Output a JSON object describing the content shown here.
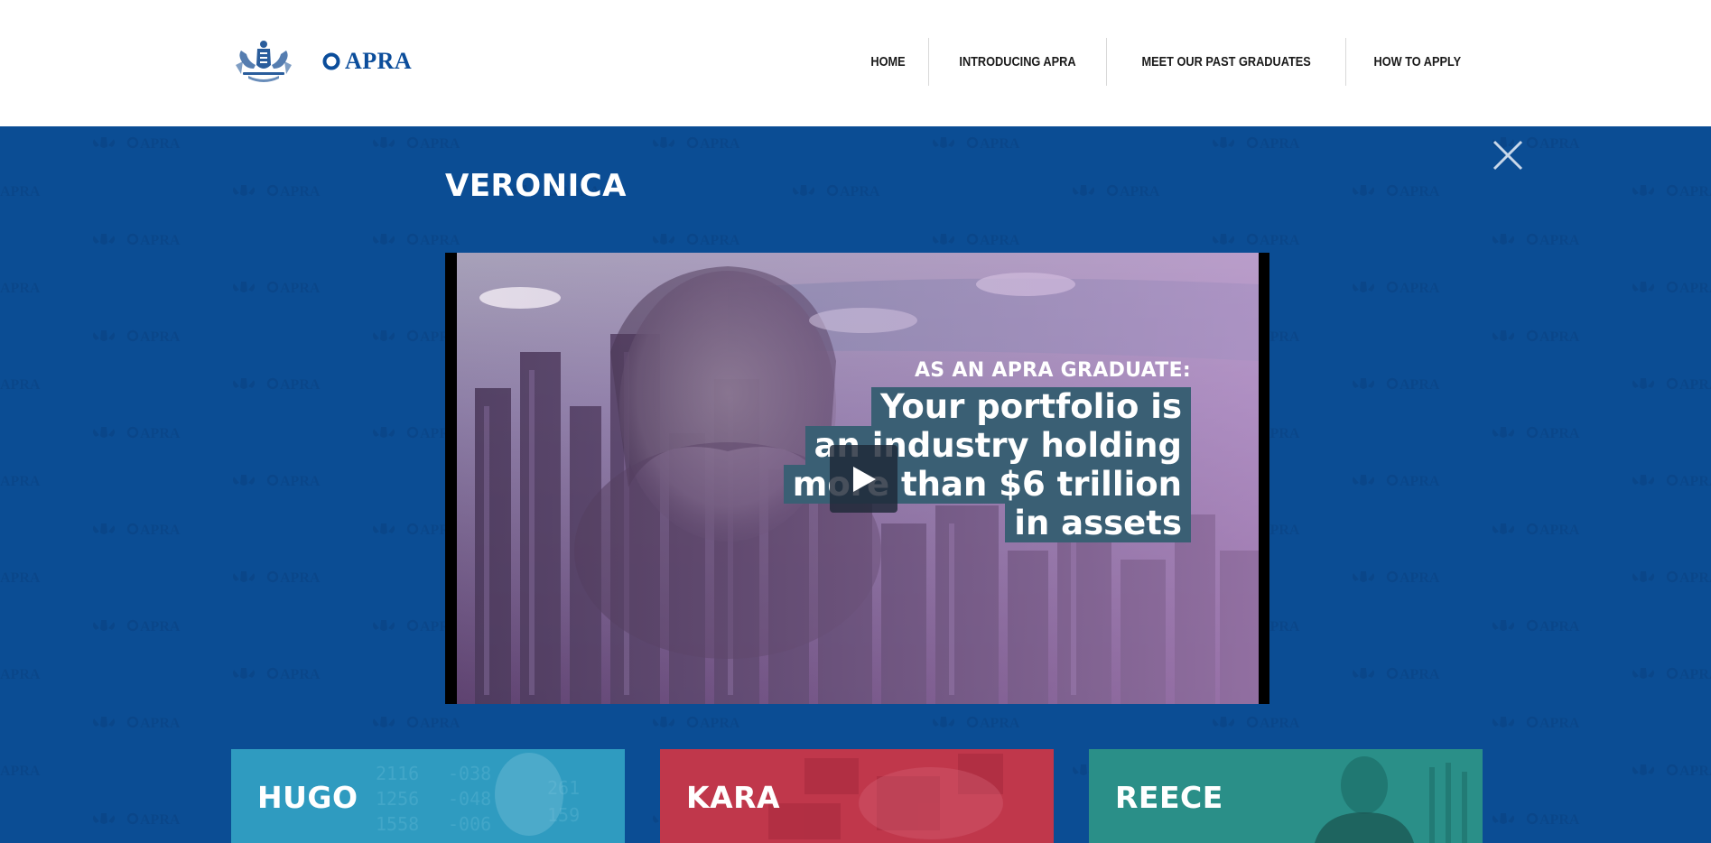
{
  "header": {
    "logo_text": "APRA",
    "crest_icon": "coat-of-arms-icon",
    "nav": [
      {
        "label": "HOME"
      },
      {
        "label": "INTRODUCING APRA"
      },
      {
        "label": "MEET OUR PAST GRADUATES"
      },
      {
        "label": "HOW TO APPLY"
      }
    ]
  },
  "modal": {
    "title": "VERONICA",
    "close_icon": "close-icon",
    "video": {
      "caption_heading": "AS AN APRA GRADUATE:",
      "caption_lines": [
        "Your portfolio is",
        "an industry holding",
        "more than $6 trillion",
        "in assets"
      ],
      "play_icon": "play-icon"
    }
  },
  "cards": [
    {
      "name": "HUGO",
      "color": "#2f9bc0"
    },
    {
      "name": "KARA",
      "color": "#c0374b"
    },
    {
      "name": "REECE",
      "color": "#2a8f88"
    }
  ],
  "colors": {
    "band": "#0b4d94",
    "brand": "#0b4d9b",
    "caption_box": "#3a5f74"
  }
}
